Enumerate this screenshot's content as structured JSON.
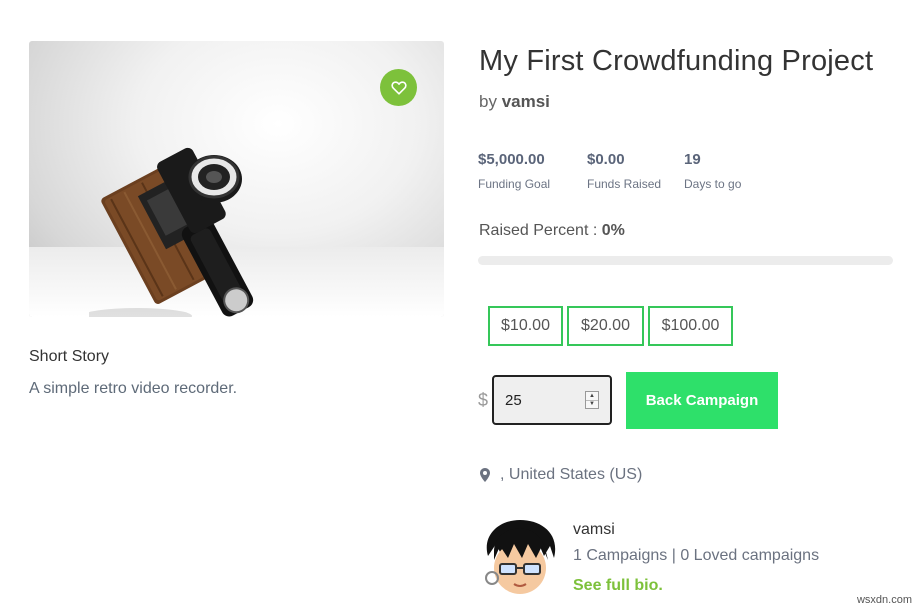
{
  "project": {
    "title": "My First Crowdfunding Project",
    "by_prefix": "by",
    "author": "vamsi"
  },
  "media": {
    "image_alt": "retro video camera",
    "love_icon": "heart-icon"
  },
  "story": {
    "title": "Short Story",
    "text": "A simple retro video recorder."
  },
  "stats": [
    {
      "value": "$5,000.00",
      "label": "Funding Goal"
    },
    {
      "value": "$0.00",
      "label": "Funds Raised"
    },
    {
      "value": "19",
      "label": "Days to go"
    }
  ],
  "raised": {
    "label": "Raised Percent :",
    "value": "0%",
    "fraction": 0
  },
  "pledge": {
    "presets": [
      "$10.00",
      "$20.00",
      "$100.00"
    ],
    "currency_symbol": "$",
    "amount_value": "25",
    "back_button": "Back Campaign"
  },
  "location": {
    "text": ", United States (US)",
    "icon": "map-pin-icon"
  },
  "author_card": {
    "name": "vamsi",
    "stats": "1 Campaigns | 0 Loved campaigns",
    "bio_link": "See full bio."
  },
  "watermark": "wsxdn.com",
  "colors": {
    "accent_green": "#7dc13b",
    "button_green": "#2ee06a",
    "preset_border": "#35c759",
    "stat_text": "#5a6479"
  }
}
